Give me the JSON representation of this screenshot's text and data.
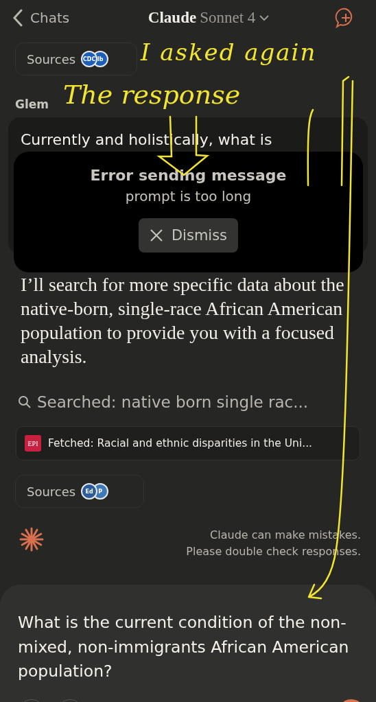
{
  "header": {
    "back_label": "Chats",
    "title_brand": "Claude",
    "title_model": "Sonnet 4"
  },
  "sources_top": {
    "label": "Sources",
    "logos": [
      {
        "text": "CDC",
        "color": "#1d5fb8"
      },
      {
        "text": "lb",
        "color": "#1d5fb8"
      }
    ]
  },
  "user_name": "Glem",
  "user_message": "Currently and holistically, what is",
  "error_toast": {
    "title": "Error sending message",
    "message": "prompt is too long",
    "button": "Dismiss"
  },
  "response": "I’ll search for more specific data about the native-born, single-race African American population to provide you with a focused analysis.",
  "search_step": "Searched: native born single rac...",
  "fetch_step": {
    "logo": "EPI",
    "text": "Fetched: Racial and ethnic disparities in the Uni..."
  },
  "sources_bottom": {
    "label": "Sources",
    "logos": [
      {
        "text": "Ed",
        "color": "#2a5d9a"
      },
      {
        "text": "P",
        "color": "#3f78b8"
      }
    ]
  },
  "disclaimer": [
    "Claude can make mistakes.",
    "Please double check responses."
  ],
  "composer": {
    "value": "What is the current condition of the non-mixed, non-immigrants African American population?"
  },
  "annotations": [
    "I asked again",
    "The response"
  ]
}
